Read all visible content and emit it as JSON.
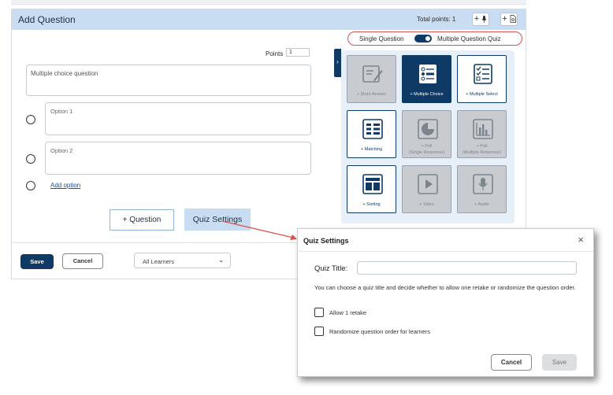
{
  "editor": {
    "title": "Add Question",
    "total_points": "Total points: 1",
    "add_text_btn": "+",
    "add_page_btn": "+",
    "mode": {
      "single": "Single Question",
      "multiple": "Multiple Question Quiz",
      "toggle_on": true
    },
    "points_label": "Points",
    "points_value": "1",
    "question_placeholder": "Multiple choice question",
    "options": [
      {
        "placeholder": "Option 1"
      },
      {
        "placeholder": "Option 2"
      }
    ],
    "add_option": "Add option",
    "add_question_btn": "+ Question",
    "quiz_settings_btn": "Quiz Settings",
    "save_btn": "Save",
    "cancel_btn": "Cancel",
    "audience_select": "All Learners"
  },
  "question_types": [
    {
      "label": "+ Short Answer",
      "icon": "pencil-note-icon",
      "state": "disabled"
    },
    {
      "label": "+ Multiple Choice",
      "icon": "radio-list-icon",
      "state": "selected"
    },
    {
      "label": "+ Multiple Select",
      "icon": "checklist-icon",
      "state": "enabled"
    },
    {
      "label": "+ Matching",
      "icon": "matching-icon",
      "state": "enabled"
    },
    {
      "label": "+ Poll",
      "sublabel": "(Single Response)",
      "icon": "pie-chart-icon",
      "state": "disabled"
    },
    {
      "label": "+ Poll",
      "sublabel": "(Multiple Response)",
      "icon": "bar-chart-icon",
      "state": "disabled"
    },
    {
      "label": "+ Sorting",
      "icon": "sorting-icon",
      "state": "enabled"
    },
    {
      "label": "+ Video",
      "icon": "video-play-icon",
      "state": "disabled"
    },
    {
      "label": "+ Audio",
      "icon": "microphone-icon",
      "state": "disabled"
    }
  ],
  "modal": {
    "title": "Quiz Settings",
    "quiz_title_label": "Quiz Title:",
    "quiz_title_value": "",
    "description": "You can choose a quiz title and decide whether to allow one retake or randomize the question order.",
    "allow_retake": "Allow 1 retake",
    "randomize": "Randomize question order for learners",
    "cancel_btn": "Cancel",
    "save_btn": "Save"
  },
  "colors": {
    "brand_navy": "#0f3a66",
    "header_blue": "#c9ddf2",
    "highlight_red": "#d9534f",
    "panel_bg": "#e7f0f9"
  }
}
